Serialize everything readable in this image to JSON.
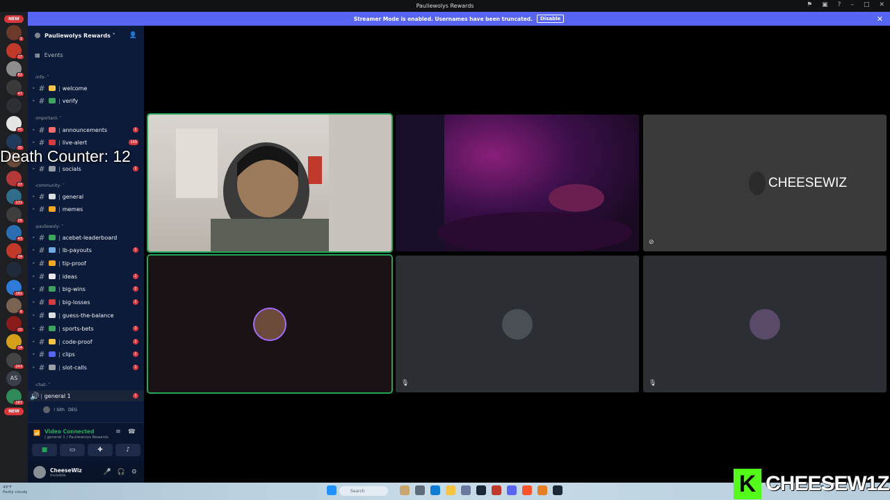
{
  "window": {
    "title": "Pauliewolys Rewards"
  },
  "streamer_bar": {
    "message": "Streamer Mode is enabled. Usernames have been truncated.",
    "disable_label": "Disable"
  },
  "guilds": {
    "new_label_top": "NEW",
    "new_label_bottom": "NEW",
    "items": [
      {
        "badge": "1",
        "color": "#6b3a2a"
      },
      {
        "badge": "17",
        "color": "#c0392b"
      },
      {
        "badge": "62",
        "color": "#8e8e8e"
      },
      {
        "badge": "47",
        "color": "#3a3a3a"
      },
      {
        "badge": "",
        "color": "#2c2f33"
      },
      {
        "badge": "40",
        "color": "#e5e5e5"
      },
      {
        "badge": "30",
        "color": "#203a5c"
      },
      {
        "badge": "",
        "color": "#6b4c3a"
      },
      {
        "badge": "37",
        "color": "#b33939"
      },
      {
        "badge": "131",
        "color": "#2f6d8a"
      },
      {
        "badge": "26",
        "color": "#3e3e3e"
      },
      {
        "badge": "43",
        "color": "#2a6fb3"
      },
      {
        "badge": "24",
        "color": "#c0392b"
      },
      {
        "badge": "",
        "color": "#1f2a3a"
      },
      {
        "badge": "182",
        "color": "#2d7bd6"
      },
      {
        "badge": "6",
        "color": "#7a6350"
      },
      {
        "badge": "10",
        "color": "#8a1c1c"
      },
      {
        "badge": "14",
        "color": "#d4a017"
      },
      {
        "badge": "243",
        "color": "#444"
      },
      {
        "badge": "",
        "color": "#3a3f4b",
        "text": "AS"
      },
      {
        "badge": "187",
        "color": "#2f8a5a"
      }
    ]
  },
  "sidebar": {
    "server_name": "Pauliewolys Rewards ˅",
    "events_label": "Events",
    "categories": {
      "info": "-info- ˅",
      "important": "-important- ˅",
      "community": "-community- ˅",
      "pauliewoly": "-pauliewoly- ˅",
      "chat": "-chat- ˅"
    },
    "channels": [
      {
        "name": "welcome",
        "emoji_color": "#f5c542",
        "count": ""
      },
      {
        "name": "verify",
        "emoji_color": "#3ba55c",
        "count": ""
      },
      {
        "name": "announcements",
        "emoji_color": "#ff6b6b",
        "count": "1"
      },
      {
        "name": "live-alert",
        "emoji_color": "#d83c3e",
        "count": "169"
      },
      {
        "name": "socials",
        "emoji_color": "#9aa0a6",
        "count": "1"
      },
      {
        "name": "general",
        "emoji_color": "#dbdee1",
        "count": ""
      },
      {
        "name": "memes",
        "emoji_color": "#f5a623",
        "count": ""
      },
      {
        "name": "acebet-leaderboard",
        "emoji_color": "#3ba55c",
        "count": ""
      },
      {
        "name": "lb-payouts",
        "emoji_color": "#6fa8dc",
        "count": "1"
      },
      {
        "name": "tip-proof",
        "emoji_color": "#f5a623",
        "count": ""
      },
      {
        "name": "ideas",
        "emoji_color": "#e8e8e8",
        "count": "1"
      },
      {
        "name": "big-wins",
        "emoji_color": "#3ba55c",
        "count": "2"
      },
      {
        "name": "big-losses",
        "emoji_color": "#d83c3e",
        "count": "1"
      },
      {
        "name": "guess-the-balance",
        "emoji_color": "#dbdee1",
        "count": ""
      },
      {
        "name": "sports-bets",
        "emoji_color": "#3ba55c",
        "count": "3"
      },
      {
        "name": "code-proof",
        "emoji_color": "#f5c542",
        "count": "1"
      },
      {
        "name": "clips",
        "emoji_color": "#5865f2",
        "count": "2"
      },
      {
        "name": "slot-calls",
        "emoji_color": "#9aa0a6",
        "count": "1"
      }
    ],
    "voice_channel": {
      "name": "general 1",
      "count": "1"
    },
    "voice_user": {
      "name": "! Sith",
      "tag": "DEG"
    }
  },
  "voice_panel": {
    "status": "Video Connected",
    "location": "| general 1 / Pauliewolys Rewards"
  },
  "user_panel": {
    "username": "CheeseWiz",
    "status": "Invisible"
  },
  "overlay": {
    "death_counter": "Death Counter: 12"
  },
  "tiles": {
    "cheesewiz_name": "CHEESEWIZ"
  },
  "taskbar": {
    "temp": "49°F",
    "weather": "Partly cloudy",
    "search": "Search"
  },
  "branding": {
    "logo_letter": "K",
    "logo_text": "CHEESEW1Z"
  },
  "colors": {
    "accent": "#5865f2",
    "speaking": "#23a55a",
    "badge": "#da373c",
    "kick_green": "#53fc18"
  }
}
